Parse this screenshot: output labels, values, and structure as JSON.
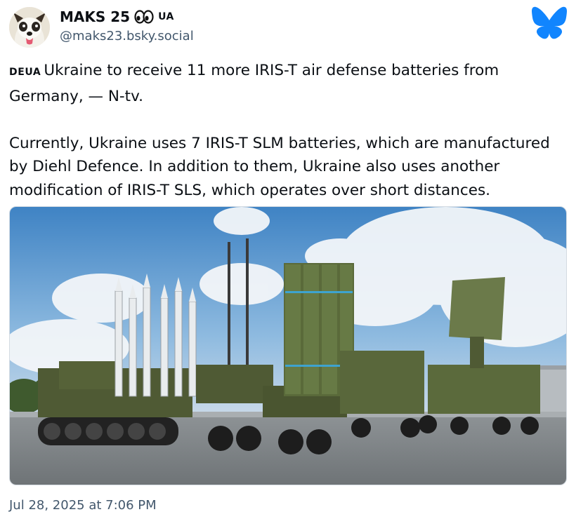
{
  "author": {
    "display_name": "MAKS 25",
    "flag_label": "UA",
    "handle": "@maks23.bsky.social",
    "avatar_icon": "dog-avatar",
    "platform_icon": "bluesky-butterfly-icon",
    "platform_color": "#1185fe"
  },
  "post": {
    "flag_prefix": "DEUA",
    "paragraphs": [
      "Ukraine to receive 11 more IRIS-T air defense batteries from Germany, — N-tv.",
      "Currently, Ukraine uses 7 IRIS-T SLM batteries, which are manufactured by Diehl Defence. In addition to them, Ukraine also uses another modification of IRIS-T SLS, which operates over short distances."
    ],
    "image": {
      "alt": "IRIS-T air defense system vehicles with missile launchers and radar parked on tarmac"
    },
    "timestamp": "Jul 28, 2025 at 7:06 PM"
  }
}
